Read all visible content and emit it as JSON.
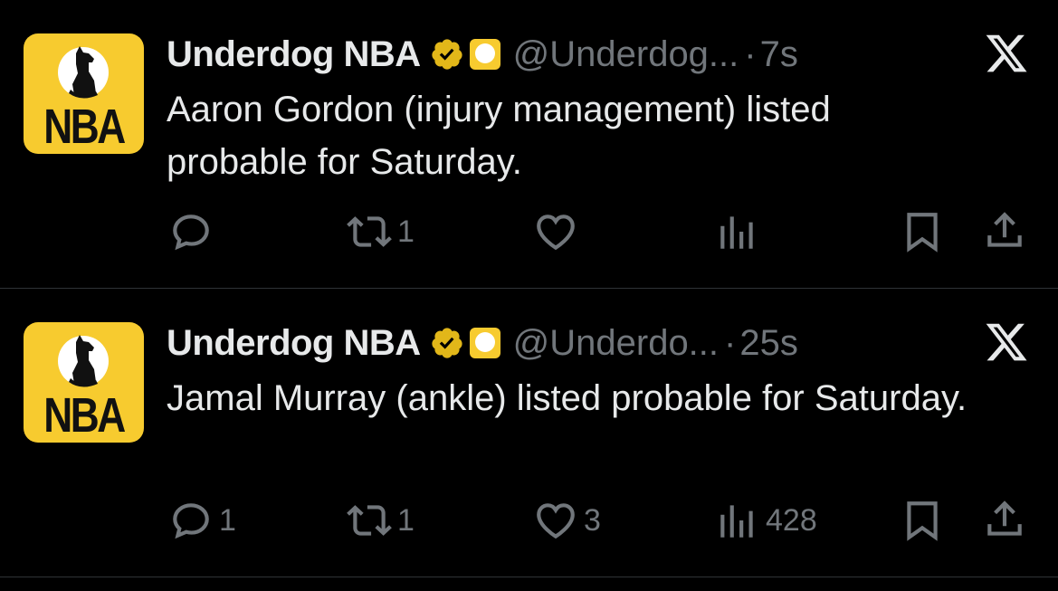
{
  "tweets": [
    {
      "avatar_text": "NBA",
      "display_name": "Underdog NBA",
      "handle": "@Underdog...",
      "separator": "·",
      "time": "7s",
      "text": "Aaron Gordon (injury management) listed probable for Saturday.",
      "replies": "",
      "retweets": "1",
      "likes": "",
      "views": ""
    },
    {
      "avatar_text": "NBA",
      "display_name": "Underdog NBA",
      "handle": "@Underdo...",
      "separator": "·",
      "time": "25s",
      "text": "Jamal Murray (ankle) listed probable for Saturday.",
      "replies": "1",
      "retweets": "1",
      "likes": "3",
      "views": "428"
    }
  ],
  "colors": {
    "background": "#000000",
    "text": "#e7e9ea",
    "secondary": "#71767b",
    "brand_yellow": "#f7cb2f",
    "verified_gold": "#e2b719",
    "divider": "#2f3336"
  },
  "icons": {
    "verified": "verified-badge-icon",
    "affiliate": "affiliate-badge-icon",
    "close": "x-close-icon",
    "reply": "reply-icon",
    "retweet": "retweet-icon",
    "like": "heart-icon",
    "views": "views-icon",
    "bookmark": "bookmark-icon",
    "share": "share-icon"
  }
}
